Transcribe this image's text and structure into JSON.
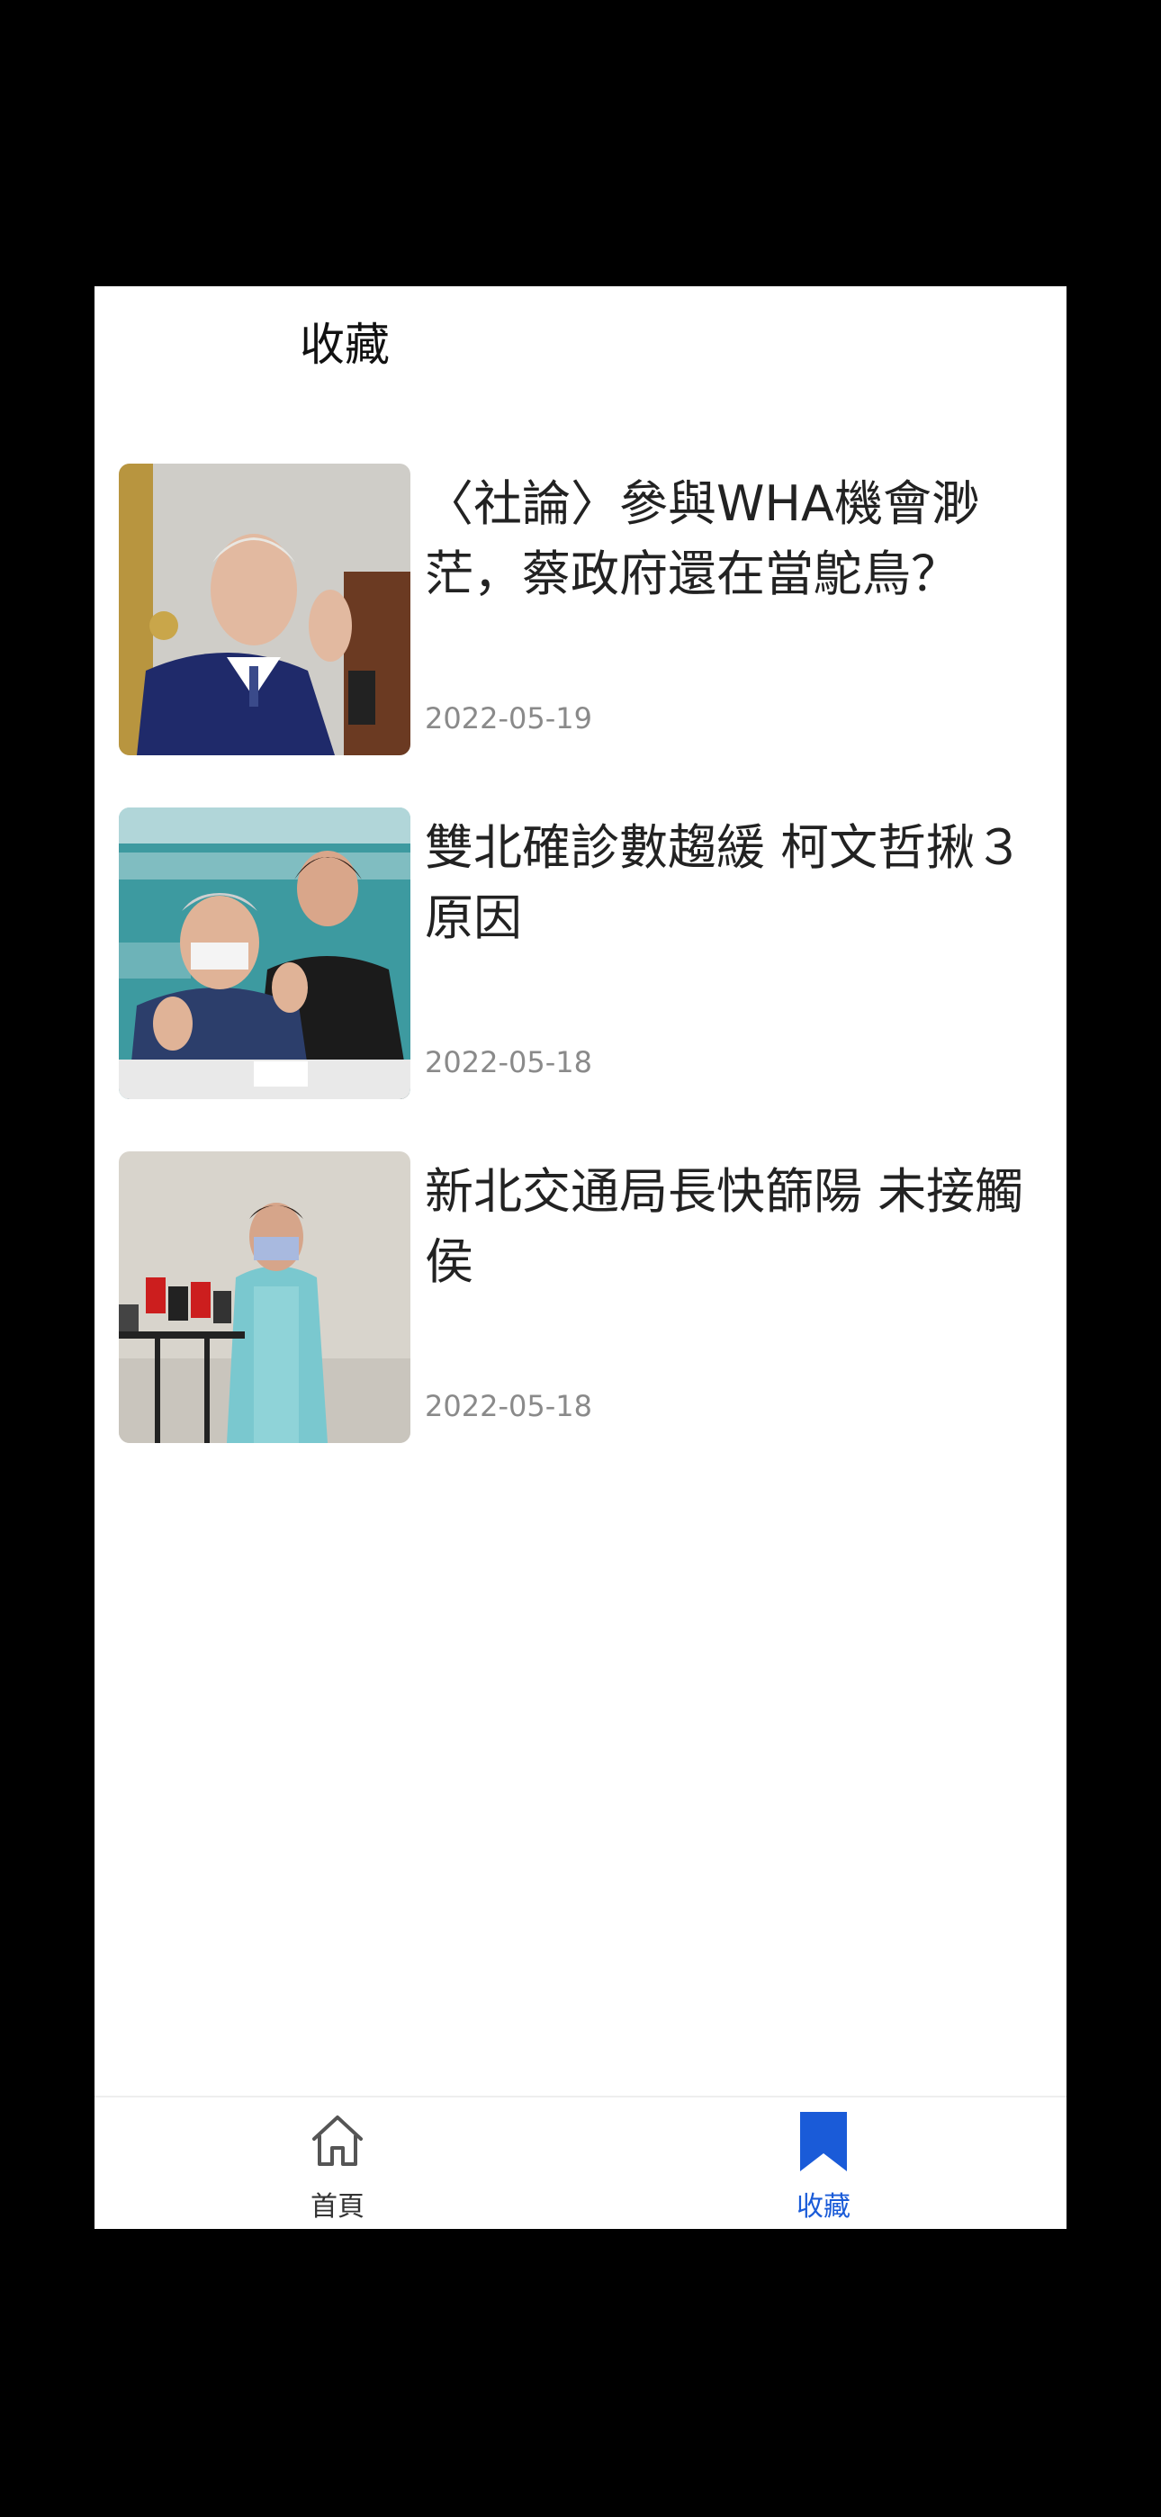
{
  "header": {
    "title": "收藏"
  },
  "articles": [
    {
      "title": "〈社論〉參與WHA機會渺茫，蔡政府還在當鴕鳥？",
      "date": "2022-05-19",
      "thumb": "speaker-photo"
    },
    {
      "title": "雙北確診數趨緩 柯文哲揪３原因",
      "date": "2022-05-18",
      "thumb": "press-conference-photo"
    },
    {
      "title": "新北交通局長快篩陽 未接觸侯",
      "date": "2022-05-18",
      "thumb": "microphones-photo"
    }
  ],
  "tabbar": {
    "home_label": "首頁",
    "favorites_label": "收藏",
    "home_icon": "home-icon",
    "favorites_icon": "bookmark-icon",
    "active_color": "#1a5bd8"
  }
}
